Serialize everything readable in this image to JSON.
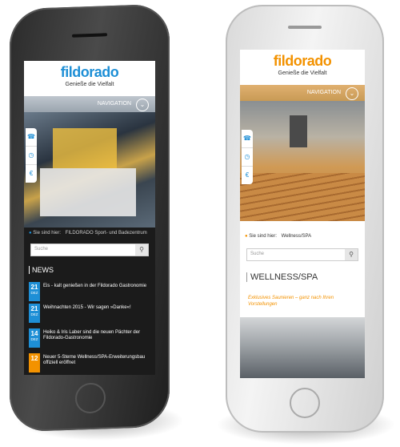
{
  "colors": {
    "brand_blue": "#1e8fd6",
    "brand_orange": "#f39200",
    "dark_screen": "#1b1b1b"
  },
  "left_phone": {
    "logo": "fildorado",
    "tagline": "Genieße die Vielfalt",
    "nav_label": "NAVIGATION",
    "nav_icon": "chevron-down-icon",
    "side_icons": [
      "phone-icon",
      "clock-icon",
      "euro-icon"
    ],
    "breadcrumb_label": "Sie sind hier:",
    "breadcrumb_value": "FILDORADO Sport- und Badezentrum",
    "search_placeholder": "Suche",
    "news_heading": "NEWS",
    "news": [
      {
        "day": "21",
        "month": "DEZ",
        "text": "Eis - kalt genießen in der Fildorado Gastronomie",
        "color": "#1e8fd6"
      },
      {
        "day": "21",
        "month": "DEZ",
        "text": "Weihnachten 2015 - Wir sagen »Danke«!",
        "color": "#1e8fd6"
      },
      {
        "day": "14",
        "month": "DEZ",
        "text": "Heiko & Iris Laber sind die neuen Pächter der Fildorado-Gastronomie",
        "color": "#1e8fd6"
      },
      {
        "day": "12",
        "month": "",
        "text": "Neuer 5-Sterne Wellness/SPA-Erweiterungsbau offiziell eröffnet",
        "color": "#f39200"
      }
    ]
  },
  "right_phone": {
    "logo": "fildorado",
    "tagline": "Genieße die Vielfalt",
    "nav_label": "NAVIGATION",
    "nav_icon": "chevron-down-icon",
    "side_icons": [
      "phone-icon",
      "clock-icon",
      "euro-icon"
    ],
    "breadcrumb_label": "Sie sind hier:",
    "breadcrumb_value": "Wellness/SPA",
    "search_placeholder": "Suche",
    "page_title": "WELLNESS/SPA",
    "subtitle": "Exklusives Saunieren – ganz nach Ihren Vorstellungen"
  }
}
